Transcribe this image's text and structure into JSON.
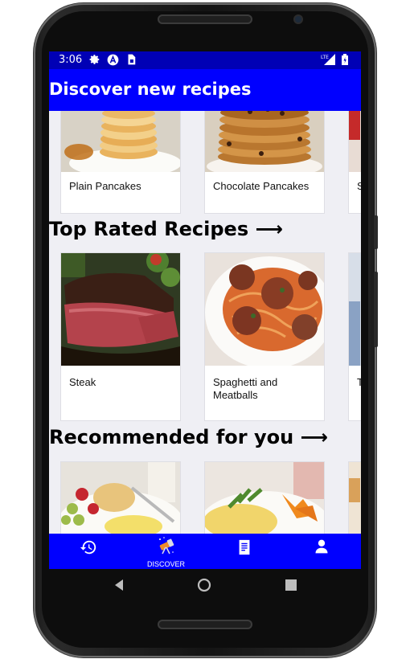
{
  "status_bar": {
    "time": "3:06",
    "icons": [
      "gear-icon",
      "a-icon",
      "sim-icon"
    ],
    "right_icons": [
      "lte-signal-icon",
      "battery-icon"
    ],
    "network_label": "LTE"
  },
  "app_bar": {
    "title": "Discover new recipes"
  },
  "sections": {
    "first_row": [
      {
        "label": "Plain Pancakes"
      },
      {
        "label": "Chocolate Pancakes"
      },
      {
        "label": "S"
      }
    ],
    "top_rated": {
      "title": "Top Rated Recipes ⟶",
      "items": [
        {
          "label": "Steak"
        },
        {
          "label": "Spaghetti and Meatballs"
        },
        {
          "label": "T"
        }
      ]
    },
    "recommended": {
      "title": "Recommended for you ⟶"
    }
  },
  "bottom_nav": {
    "items": [
      {
        "icon": "history-icon",
        "label": ""
      },
      {
        "icon": "telescope-icon",
        "label": "DISCOVER"
      },
      {
        "icon": "document-icon",
        "label": ""
      },
      {
        "icon": "person-icon",
        "label": ""
      }
    ]
  },
  "colors": {
    "app_bar": "#0000ff",
    "status_bar": "#0000b5",
    "bottom_nav": "#0000ff",
    "background": "#efeff4"
  }
}
